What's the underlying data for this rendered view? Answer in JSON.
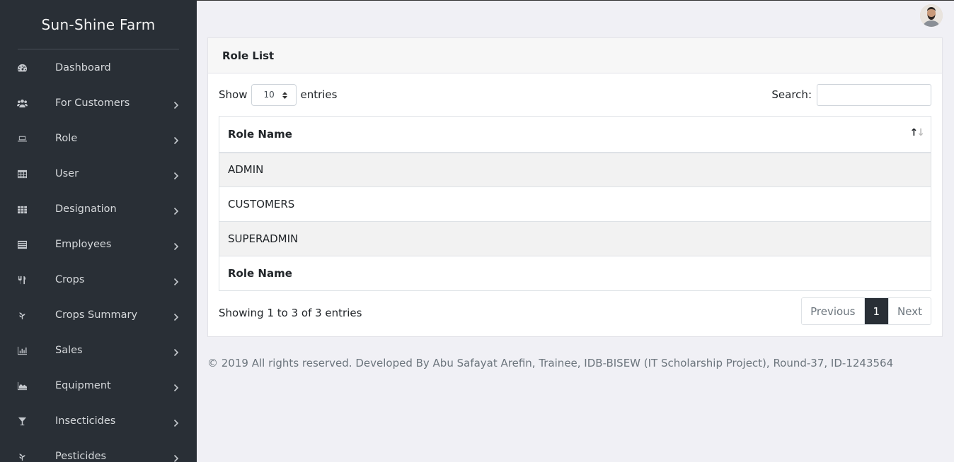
{
  "app": {
    "brand": "Sun-Shine Farm"
  },
  "sidebar": {
    "items": [
      {
        "label": "Dashboard",
        "icon": "dashboard-icon",
        "has_children": false
      },
      {
        "label": "For Customers",
        "icon": "users-icon",
        "has_children": true
      },
      {
        "label": "Role",
        "icon": "laptop-icon",
        "has_children": true
      },
      {
        "label": "User",
        "icon": "table-icon",
        "has_children": true
      },
      {
        "label": "Designation",
        "icon": "grid-icon",
        "has_children": true
      },
      {
        "label": "Employees",
        "icon": "list-icon",
        "has_children": true
      },
      {
        "label": "Crops",
        "icon": "utensils-icon",
        "has_children": true
      },
      {
        "label": "Crops Summary",
        "icon": "plant-icon",
        "has_children": true
      },
      {
        "label": "Sales",
        "icon": "bar-chart-icon",
        "has_children": true
      },
      {
        "label": "Equipment",
        "icon": "area-chart-icon",
        "has_children": true
      },
      {
        "label": "Insecticides",
        "icon": "glass-icon",
        "has_children": true
      },
      {
        "label": "Pesticides",
        "icon": "plant-icon",
        "has_children": true
      }
    ]
  },
  "card": {
    "title": "Role List"
  },
  "length": {
    "show": "Show",
    "value": "10",
    "entries": "entries"
  },
  "search": {
    "label": "Search:",
    "value": "",
    "placeholder": ""
  },
  "table": {
    "header": "Role Name",
    "rows": [
      "ADMIN",
      "CUSTOMERS",
      "SUPERADMIN"
    ],
    "footer": "Role Name"
  },
  "info": "Showing 1 to 3 of 3 entries",
  "pagination": {
    "previous": "Previous",
    "current": "1",
    "next": "Next"
  },
  "footer": "© 2019 All rights reserved. Developed By Abu Safayat Arefin, Trainee, IDB-BISEW (IT Scholarship Project), Round-37, ID-1243564",
  "colors": {
    "sidebar_bg": "#292f36",
    "page_bg": "#f0f0f5",
    "active_page": "#292f36"
  }
}
